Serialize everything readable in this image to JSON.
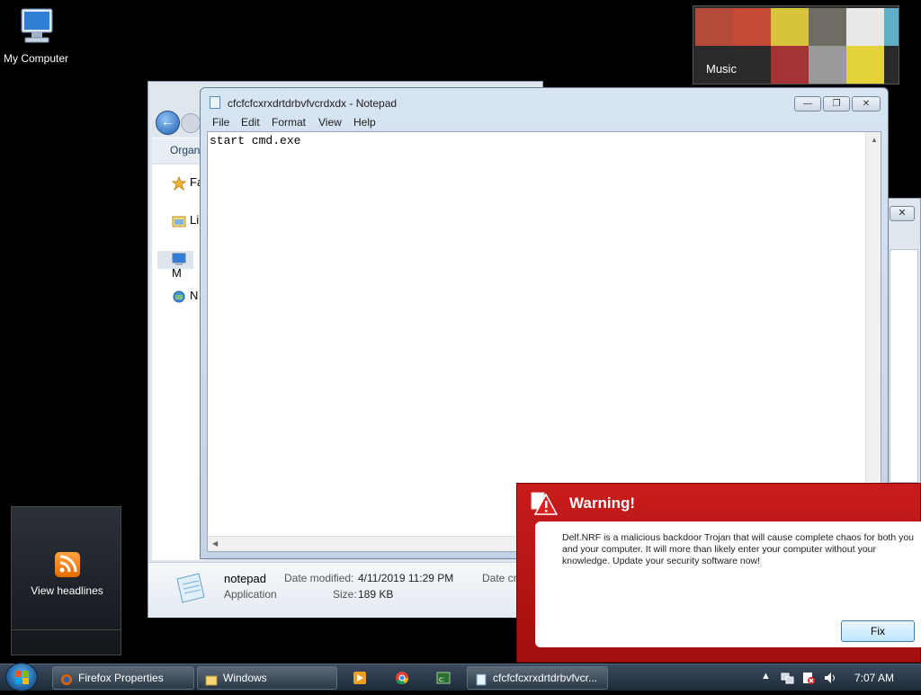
{
  "desktop": {
    "icons": [
      {
        "label": "My Computer",
        "icon": "computer-icon"
      }
    ]
  },
  "gadgets": {
    "media": {
      "label": "Music"
    },
    "feed": {
      "label": "View headlines",
      "icon": "rss-icon"
    }
  },
  "explorer": {
    "toolbar_label": "Organ",
    "nav_items": [
      {
        "label": "Fa",
        "icon": "star-icon"
      },
      {
        "label": "Li",
        "icon": "library-icon"
      },
      {
        "label": "M",
        "icon": "computer-icon"
      },
      {
        "label": "N",
        "icon": "network-icon"
      }
    ],
    "details": {
      "name": "notepad",
      "type": "Application",
      "date_modified_label": "Date modified:",
      "date_modified": "4/11/2019 11:29 PM",
      "size_label": "Size:",
      "size": "189 KB",
      "date_created_label": "Date cr"
    }
  },
  "notepad": {
    "title": "cfcfcfcxrxdrtdrbvfvcrdxdx - Notepad",
    "menu": [
      "File",
      "Edit",
      "Format",
      "View",
      "Help"
    ],
    "content": "start cmd.exe"
  },
  "warning": {
    "title": "Warning!",
    "message": "Delf.NRF is a malicious backdoor Trojan that will cause complete chaos for both you and your computer. It will more than likely enter your computer without your knowledge. Update your security software now!",
    "button": "Fix"
  },
  "taskbar": {
    "tasks": [
      {
        "label": "Firefox Properties",
        "icon": "firefox-icon"
      },
      {
        "label": "Windows",
        "icon": "folder-icon"
      },
      {
        "label": "cfcfcfcxrxdrtdrbvfvcr...",
        "icon": "notepad-icon"
      }
    ],
    "clock": "7:07 AM"
  },
  "colors": {
    "warning_red": "#c81c1c",
    "taskbar": "#1d2a38",
    "window_frame": "#c4d3e5"
  }
}
